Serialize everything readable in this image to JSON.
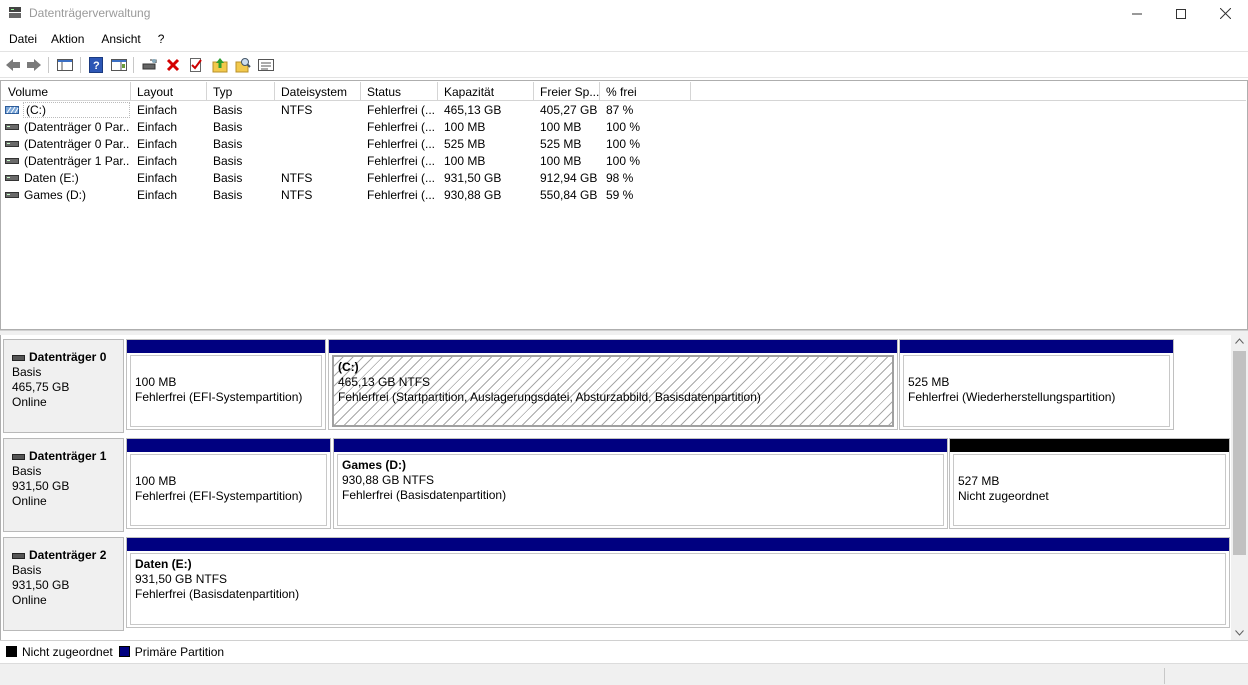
{
  "window": {
    "title": "Datenträgerverwaltung",
    "minimize": "—",
    "maximize": "☐",
    "close": "✕"
  },
  "menu": [
    "Datei",
    "Aktion",
    "Ansicht",
    "?"
  ],
  "toolbar": {
    "icons": [
      "back-icon",
      "forward-icon",
      "console-tree-icon",
      "help-icon",
      "properties-panel-icon",
      "connect-disk-icon",
      "delete-icon",
      "check-icon",
      "up-folder-icon",
      "search-folder-icon",
      "list-view-icon"
    ],
    "delete_color": "#d40000"
  },
  "volume_list": {
    "columns": [
      "Volume",
      "Layout",
      "Typ",
      "Dateisystem",
      "Status",
      "Kapazität",
      "Freier Sp...",
      "% frei"
    ],
    "rows": [
      {
        "volume": "(C:)",
        "layout": "Einfach",
        "typ": "Basis",
        "dateisystem": "NTFS",
        "status": "Fehlerfrei (...",
        "kapazitaet": "465,13 GB",
        "frei": "405,27 GB",
        "prozent": "87 %",
        "icon": "striped-volume-icon"
      },
      {
        "volume": "(Datenträger 0 Par...",
        "layout": "Einfach",
        "typ": "Basis",
        "dateisystem": "",
        "status": "Fehlerfrei (...",
        "kapazitaet": "100 MB",
        "frei": "100 MB",
        "prozent": "100 %",
        "icon": "volume-icon"
      },
      {
        "volume": "(Datenträger 0 Par...",
        "layout": "Einfach",
        "typ": "Basis",
        "dateisystem": "",
        "status": "Fehlerfrei (...",
        "kapazitaet": "525 MB",
        "frei": "525 MB",
        "prozent": "100 %",
        "icon": "volume-icon"
      },
      {
        "volume": "(Datenträger 1 Par...",
        "layout": "Einfach",
        "typ": "Basis",
        "dateisystem": "",
        "status": "Fehlerfrei (...",
        "kapazitaet": "100 MB",
        "frei": "100 MB",
        "prozent": "100 %",
        "icon": "volume-icon"
      },
      {
        "volume": "Daten (E:)",
        "layout": "Einfach",
        "typ": "Basis",
        "dateisystem": "NTFS",
        "status": "Fehlerfrei (...",
        "kapazitaet": "931,50 GB",
        "frei": "912,94 GB",
        "prozent": "98 %",
        "icon": "volume-icon"
      },
      {
        "volume": "Games (D:)",
        "layout": "Einfach",
        "typ": "Basis",
        "dateisystem": "NTFS",
        "status": "Fehlerfrei (...",
        "kapazitaet": "930,88 GB",
        "frei": "550,84 GB",
        "prozent": "59 %",
        "icon": "volume-icon"
      }
    ]
  },
  "disks": [
    {
      "name": "Datenträger 0",
      "type": "Basis",
      "size": "465,75 GB",
      "state": "Online",
      "partitions": [
        {
          "name": "",
          "size": "100 MB",
          "status": "Fehlerfrei (EFI-Systempartition)",
          "kind": "primary",
          "selected": false
        },
        {
          "name": "(C:)",
          "size": "465,13 GB NTFS",
          "status": "Fehlerfrei (Startpartition, Auslagerungsdatei, Absturzabbild, Basisdatenpartition)",
          "kind": "primary",
          "selected": true
        },
        {
          "name": "",
          "size": "525 MB",
          "status": "Fehlerfrei (Wiederherstellungspartition)",
          "kind": "primary",
          "selected": false
        }
      ]
    },
    {
      "name": "Datenträger 1",
      "type": "Basis",
      "size": "931,50 GB",
      "state": "Online",
      "partitions": [
        {
          "name": "",
          "size": "100 MB",
          "status": "Fehlerfrei (EFI-Systempartition)",
          "kind": "primary",
          "selected": false
        },
        {
          "name": "Games  (D:)",
          "size": "930,88 GB NTFS",
          "status": "Fehlerfrei (Basisdatenpartition)",
          "kind": "primary",
          "selected": false
        },
        {
          "name": "",
          "size": "527 MB",
          "status": "Nicht zugeordnet",
          "kind": "unallocated",
          "selected": false
        }
      ]
    },
    {
      "name": "Datenträger 2",
      "type": "Basis",
      "size": "931,50 GB",
      "state": "Online",
      "partitions": [
        {
          "name": "Daten  (E:)",
          "size": "931,50 GB NTFS",
          "status": "Fehlerfrei (Basisdatenpartition)",
          "kind": "primary",
          "selected": false
        }
      ]
    }
  ],
  "legend": [
    {
      "label": "Nicht zugeordnet",
      "color": "#000000"
    },
    {
      "label": "Primäre Partition",
      "color": "#000080"
    }
  ],
  "colors": {
    "primary": "#000080",
    "unallocated": "#000000"
  }
}
